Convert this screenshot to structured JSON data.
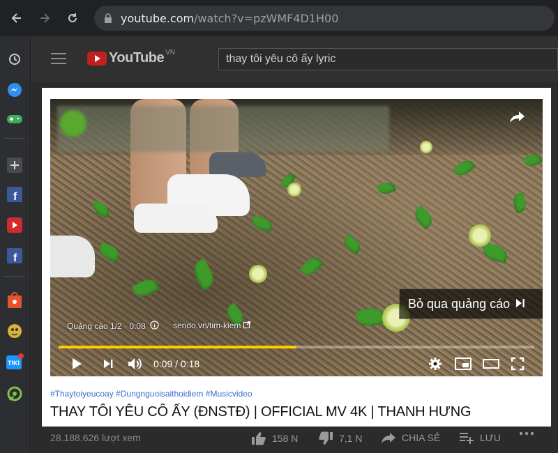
{
  "browser": {
    "url_host": "youtube.com",
    "url_path": "/watch?v=pzWMF4D1H00"
  },
  "youtube": {
    "logo_text": "YouTube",
    "region": "VN",
    "search_value": "thay tôi yêu cô ấy lyric"
  },
  "player": {
    "ad_label": "Quảng cáo 1/2 · 0:08",
    "ad_link": "sendo.vn/tim-kiem",
    "skip_label": "Bỏ qua quảng cáo",
    "time": "0:09 / 0:18",
    "progress_fraction": 0.5
  },
  "video": {
    "hashtags": "#Thaytoiyeucoay #Dungnguoisaithoidiem #Musicvideo",
    "title": "THAY TÔI YÊU CÔ ẤY (ĐNSTĐ) | OFFICIAL MV 4K | THANH HƯNG",
    "views": "28.188.626 lượt xem",
    "likes": "158 N",
    "dislikes": "7,1 N",
    "share_label": "CHIA SẺ",
    "save_label": "LƯU"
  },
  "colors": {
    "progress": "#ffcc00",
    "youtube_red": "#c0201f",
    "hashtag": "#3a6fc8"
  }
}
